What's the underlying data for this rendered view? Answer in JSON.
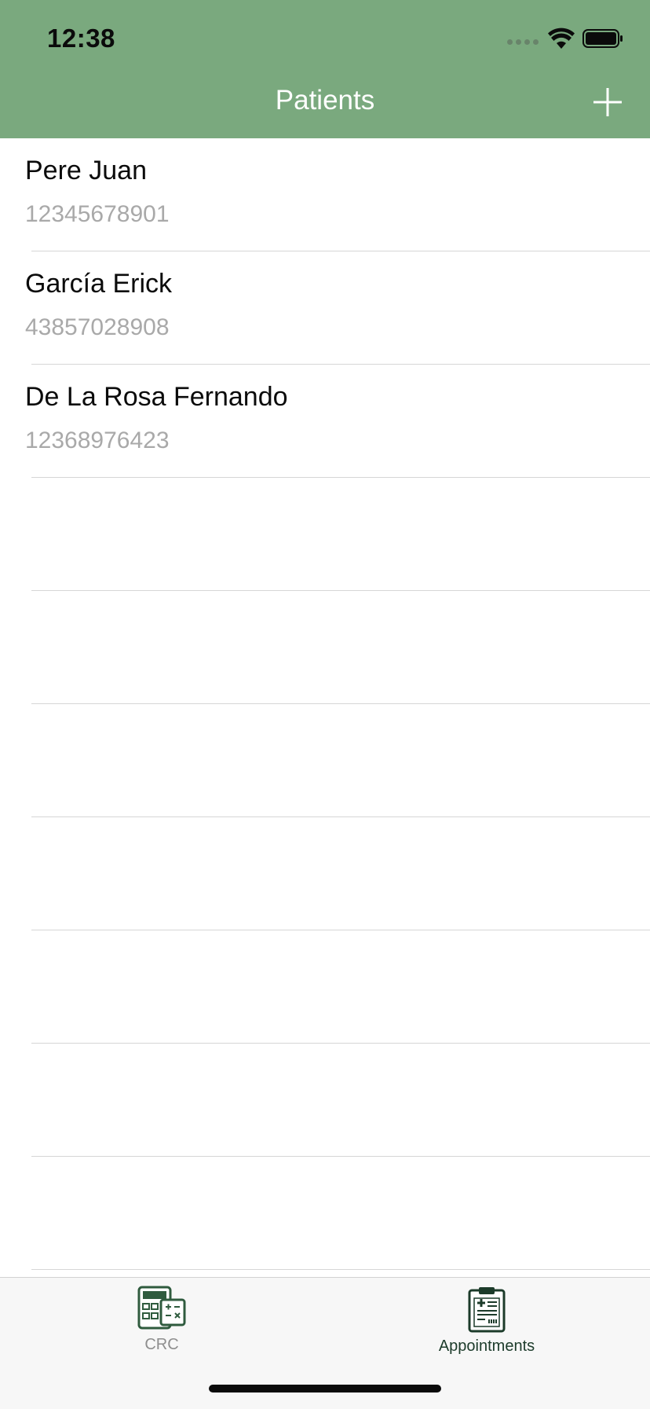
{
  "status_bar": {
    "time": "12:38"
  },
  "nav": {
    "title": "Patients",
    "add_icon": "plus-icon"
  },
  "patients": [
    {
      "name": "Pere Juan",
      "id": "12345678901"
    },
    {
      "name": "García Erick",
      "id": "43857028908"
    },
    {
      "name": "De La Rosa Fernando",
      "id": "12368976423"
    }
  ],
  "tabs": [
    {
      "label": "CRC",
      "icon": "calculator-icon",
      "selected": false
    },
    {
      "label": "Appointments",
      "icon": "clipboard-medical-icon",
      "selected": true
    }
  ],
  "colors": {
    "header_bg": "#7aa97e",
    "tab_active": "#1c3b2a",
    "tab_inactive": "#8e8e8e",
    "secondary_text": "#a9a9a9"
  }
}
